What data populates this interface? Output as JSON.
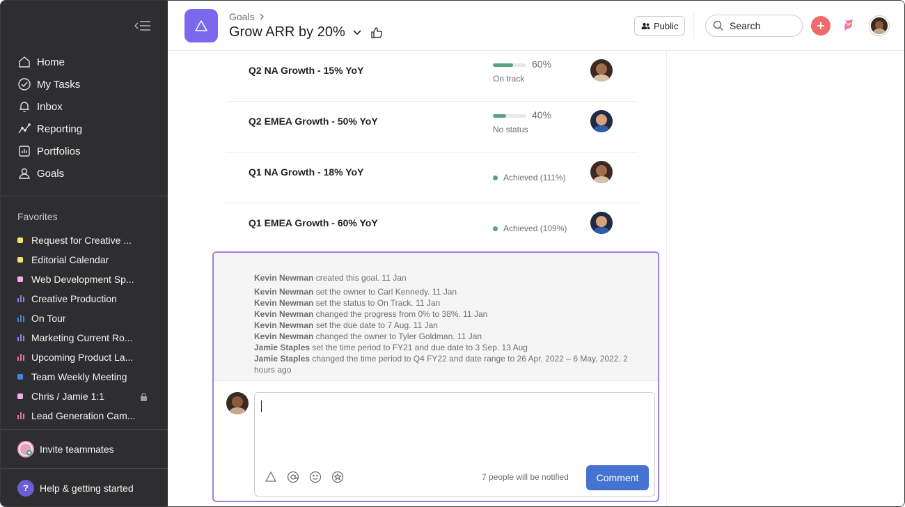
{
  "sidebar": {
    "nav": [
      {
        "label": "Home",
        "icon": "home-icon"
      },
      {
        "label": "My Tasks",
        "icon": "check-circle-icon"
      },
      {
        "label": "Inbox",
        "icon": "bell-icon"
      },
      {
        "label": "Reporting",
        "icon": "chart-line-icon"
      },
      {
        "label": "Portfolios",
        "icon": "portfolio-icon"
      },
      {
        "label": "Goals",
        "icon": "person-icon"
      }
    ],
    "favorites_title": "Favorites",
    "favorites": [
      {
        "label": "Request for Creative ...",
        "kind": "dot",
        "color": "#f8df72"
      },
      {
        "label": "Editorial Calendar",
        "kind": "dot",
        "color": "#f8df72"
      },
      {
        "label": "Web Development Sp...",
        "kind": "dot",
        "color": "#f9aaef"
      },
      {
        "label": "Creative Production",
        "kind": "bars",
        "color": "#8d84e8"
      },
      {
        "label": "On Tour",
        "kind": "bars",
        "color": "#4186e0"
      },
      {
        "label": "Marketing Current Ro...",
        "kind": "bars",
        "color": "#8d84e8"
      },
      {
        "label": "Upcoming Product La...",
        "kind": "bars",
        "color": "#f26fb2"
      },
      {
        "label": "Team Weekly Meeting",
        "kind": "dot",
        "color": "#4186e0"
      },
      {
        "label": "Chris / Jamie 1:1",
        "kind": "dot",
        "color": "#f9aaef"
      },
      {
        "label": "Lead Generation Cam...",
        "kind": "bars",
        "color": "#f26fb2"
      }
    ],
    "invite_label": "Invite teammates",
    "help_label": "Help & getting started",
    "help_glyph": "?"
  },
  "header": {
    "breadcrumb": "Goals",
    "title": "Grow ARR by 20%",
    "public_label": "Public",
    "search_placeholder": "Search",
    "add_glyph": "+",
    "accent": "#7b68ee"
  },
  "goals": [
    {
      "name": "Q2 NA Growth - 15% YoY",
      "type": "progress",
      "progress": 60,
      "pct_label": "60%",
      "status": "On track"
    },
    {
      "name": "Q2 EMEA Growth - 50% YoY",
      "type": "progress",
      "progress": 40,
      "pct_label": "40%",
      "status": "No status"
    },
    {
      "name": "Q1 NA Growth - 18% YoY",
      "type": "achieved",
      "status": "Achieved (111%)"
    },
    {
      "name": "Q1 EMEA Growth - 60% YoY",
      "type": "achieved",
      "status": "Achieved (109%)"
    }
  ],
  "activity": [
    {
      "actor": "Kevin Newman",
      "text": " created this goal.  11 Jan"
    },
    {
      "actor": "Kevin Newman",
      "text": " set the owner to Carl Kennedy.  11 Jan"
    },
    {
      "actor": "Kevin Newman",
      "text": " set the status to On Track.  11 Jan"
    },
    {
      "actor": "Kevin Newman",
      "text": " changed the progress from 0% to 38%.  11 Jan"
    },
    {
      "actor": "Kevin Newman",
      "text": " set the due date to 7 Aug.  11 Jan"
    },
    {
      "actor": "Kevin Newman",
      "text": " changed the owner to Tyler Goldman.  11 Jan"
    },
    {
      "actor": "Jamie Staples",
      "text": " set the time period to FY21 and due date to 3 Sep.  13 Aug"
    },
    {
      "actor": "Jamie Staples",
      "text": " changed the time period to Q4 FY22 and date range to 26 Apr, 2022 – 6 May, 2022.  2 hours ago"
    }
  ],
  "comment": {
    "notify_text": "7 people will be notified",
    "button_label": "Comment",
    "tools": [
      "goal-icon",
      "mention-icon",
      "emoji-icon",
      "star-icon"
    ]
  }
}
